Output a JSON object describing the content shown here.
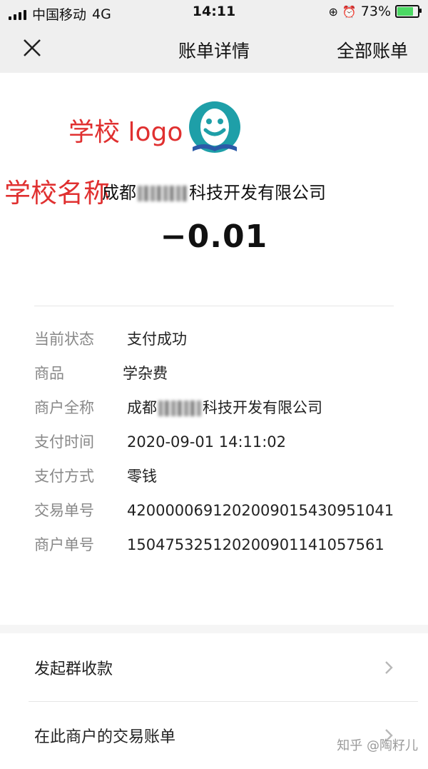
{
  "status_bar": {
    "carrier": "中国移动",
    "network": "4G",
    "time": "14:11",
    "battery": "73%"
  },
  "nav": {
    "title": "账单详情",
    "right_link": "全部账单"
  },
  "annotations": {
    "logo_label": "学校 logo",
    "name_label": "学校名称"
  },
  "header": {
    "company_prefix": "成都",
    "company_suffix": "科技开发有限公司",
    "amount": "−0.01"
  },
  "details": [
    {
      "key": "当前状态",
      "value": "支付成功"
    },
    {
      "key": "商品",
      "value": "学杂费"
    },
    {
      "key": "商户全称",
      "value_prefix": "成都",
      "value_suffix": "科技开发有限公司"
    },
    {
      "key": "支付时间",
      "value": "2020-09-01 14:11:02"
    },
    {
      "key": "支付方式",
      "value": "零钱"
    },
    {
      "key": "交易单号",
      "value": "420000069120200901543095​1041"
    },
    {
      "key": "商户单号",
      "value": "1504753251202009011410575​61"
    }
  ],
  "actions": {
    "group_pay": "发起群收款",
    "merchant_bills": "在此商户的交易账单"
  },
  "watermark": "知乎 @陶籽儿",
  "colors": {
    "accent_red": "#e03030",
    "logo_teal": "#1e9fa8",
    "battery_green": "#4cd964"
  }
}
